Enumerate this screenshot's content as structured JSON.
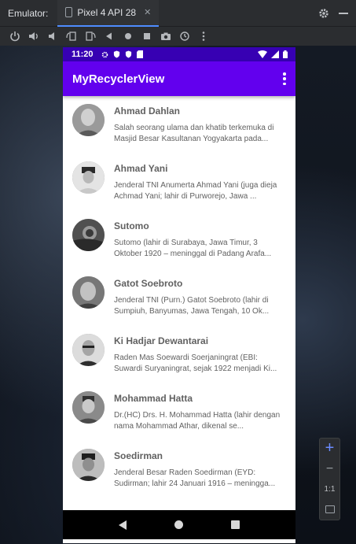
{
  "emulator": {
    "label": "Emulator:",
    "device_tab": "Pixel 4 API 28"
  },
  "toolbar_icons": [
    "power-icon",
    "volume-up-icon",
    "volume-down-icon",
    "rotate-left-icon",
    "rotate-right-icon",
    "back-icon",
    "home-icon",
    "overview-icon",
    "screenshot-icon",
    "snapshot-icon",
    "more-icon"
  ],
  "phone": {
    "time": "11:20",
    "app_title": "MyRecyclerView",
    "items": [
      {
        "name": "Ahmad Dahlan",
        "description": "Salah seorang ulama dan khatib terkemuka di Masjid Besar Kasultanan Yogyakarta pada..."
      },
      {
        "name": "Ahmad Yani",
        "description": "Jenderal TNI Anumerta Ahmad Yani (juga dieja Achmad Yani; lahir di Purworejo, Jawa ..."
      },
      {
        "name": "Sutomo",
        "description": "Sutomo (lahir di Surabaya, Jawa Timur, 3 Oktober 1920 – meninggal di Padang Arafa..."
      },
      {
        "name": "Gatot Soebroto",
        "description": "Jenderal TNI (Purn.) Gatot Soebroto (lahir di Sumpiuh, Banyumas, Jawa Tengah, 10 Ok..."
      },
      {
        "name": "Ki Hadjar Dewantarai",
        "description": "Raden Mas Soewardi Soerjaningrat (EBI: Suwardi Suryaningrat, sejak 1922 menjadi Ki..."
      },
      {
        "name": "Mohammad Hatta",
        "description": "Dr.(HC) Drs. H. Mohammad Hatta (lahir dengan nama Mohammad Athar, dikenal se..."
      },
      {
        "name": "Soedirman",
        "description": "Jenderal Besar Raden Soedirman (EYD: Sudirman; lahir 24 Januari 1916 – meningga..."
      }
    ]
  },
  "zoom": {
    "one_to_one": "1:1"
  },
  "colors": {
    "status_bar": "#3700b3",
    "app_bar": "#6200ee",
    "text": "#616161"
  }
}
